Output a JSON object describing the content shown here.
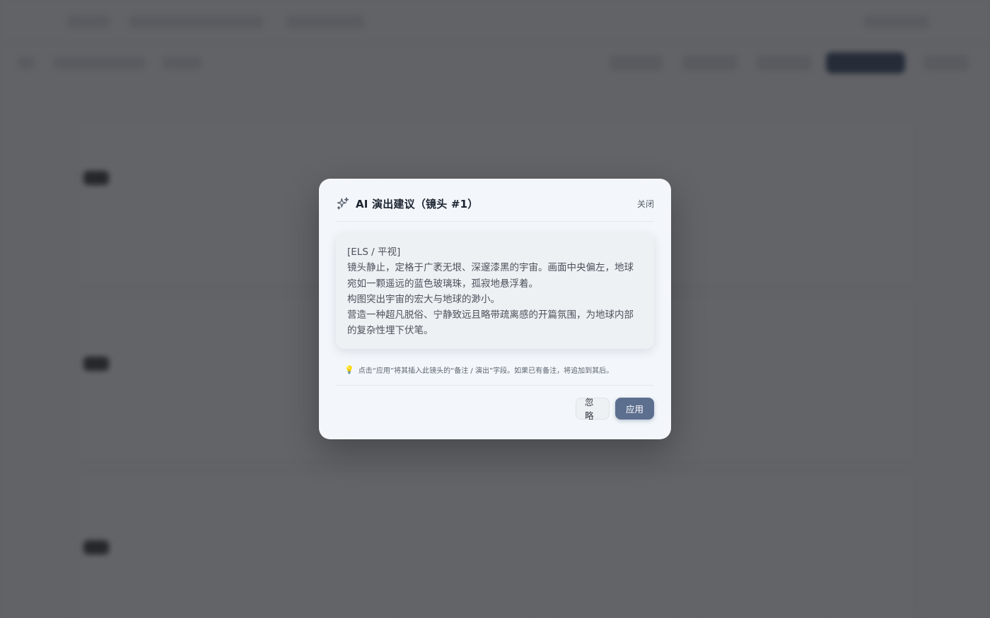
{
  "modal": {
    "title": "AI 演出建议（镜头 #1）",
    "close_label": "关闭",
    "suggestion_lines": [
      "[ELS / 平视]",
      "镜头静止，定格于广袤无垠、深邃漆黑的宇宙。画面中央偏左，地球宛如一颗遥远的蓝色玻璃珠，孤寂地悬浮着。",
      "构图突出宇宙的宏大与地球的渺小。",
      "营造一种超凡脱俗、宁静致远且略带疏离感的开篇氛围，为地球内部的复杂性埋下伏笔。"
    ],
    "hint_icon": "lightbulb-icon",
    "hint": "点击“应用”将其插入此镜头的“备注 / 演出”字段。如果已有备注，将追加到其后。",
    "buttons": {
      "ignore": "忽略",
      "apply": "应用"
    }
  },
  "colors": {
    "apply_button": "#5d6f8e",
    "modal_background": "#f3f7fb",
    "overlay": "#282a2e"
  }
}
